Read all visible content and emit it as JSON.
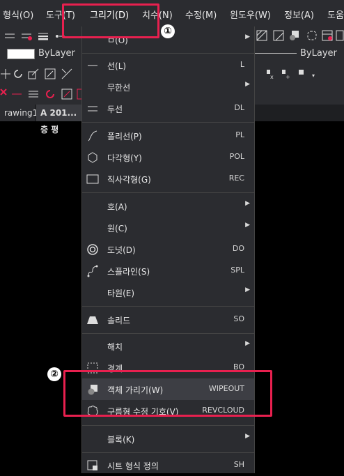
{
  "menubar": {
    "items": [
      "형식(O)",
      "도구(T)",
      "그리기(D)",
      "치수(N)",
      "수정(M)",
      "윈도우(W)",
      "정보(A)",
      "도움"
    ]
  },
  "layer": {
    "left": "ByLayer",
    "right": "ByLayer"
  },
  "tabs": {
    "tab1": "rawing1",
    "tab2": "A 201...층 평"
  },
  "draw_menu": {
    "items": [
      {
        "label": "선(L)",
        "shortcut": "L"
      },
      {
        "label": "무한선",
        "shortcut": ""
      },
      {
        "label": "두선",
        "shortcut": "DL"
      },
      {
        "label": "폴리선(P)",
        "shortcut": "PL"
      },
      {
        "label": "다각형(Y)",
        "shortcut": "POL"
      },
      {
        "label": "직사각형(G)",
        "shortcut": "REC"
      },
      {
        "label": "호(A)",
        "shortcut": ""
      },
      {
        "label": "원(C)",
        "shortcut": ""
      },
      {
        "label": "도넛(D)",
        "shortcut": "DO"
      },
      {
        "label": "스플라인(S)",
        "shortcut": "SPL"
      },
      {
        "label": "타원(E)",
        "shortcut": ""
      },
      {
        "label": "솔리드",
        "shortcut": "SO"
      },
      {
        "label": "해치",
        "shortcut": ""
      },
      {
        "label": "경계",
        "shortcut": "BO"
      },
      {
        "label": "객체 가리기(W)",
        "shortcut": "WIPEOUT"
      },
      {
        "label": "구름형 수정 기호(V)",
        "shortcut": "REVCLOUD"
      },
      {
        "label": "블록(K)",
        "shortcut": ""
      },
      {
        "label": "시트 형식 정의",
        "shortcut": "SH"
      }
    ],
    "first_partial_label": "ㅁ(O)"
  },
  "callouts": {
    "one": "①",
    "two": "②"
  },
  "colors": {
    "callout": "#e8204f",
    "menu_bg": "#2b2c30",
    "highlight": "#3d3e44"
  }
}
